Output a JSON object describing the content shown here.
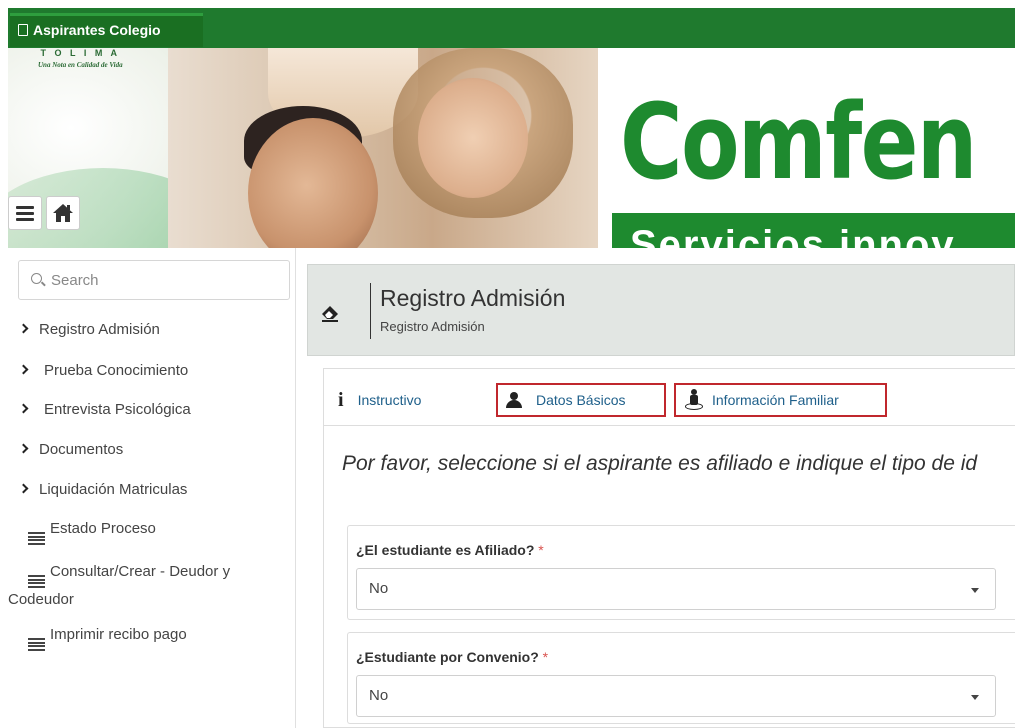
{
  "app": {
    "tab_title": "Aspirantes Colegio"
  },
  "banner": {
    "logo_region": "T O L I M A",
    "logo_tagline": "Una Nota en Calidad de Vida",
    "brand": "Comfen",
    "slogan": "Servicios innov"
  },
  "search": {
    "placeholder": "Search"
  },
  "sidebar": {
    "items": [
      {
        "label": "Registro Admisión",
        "icon": "chevron-right-icon"
      },
      {
        "label": "Prueba Conocimiento",
        "icon": "chevron-right-icon"
      },
      {
        "label": "Entrevista Psicológica",
        "icon": "chevron-right-icon"
      },
      {
        "label": "Documentos",
        "icon": "chevron-right-icon"
      },
      {
        "label": "Liquidación Matriculas",
        "icon": "chevron-right-icon"
      },
      {
        "label": "Estado Proceso",
        "icon": "list-icon"
      },
      {
        "label_line1": "Consultar/Crear - Deudor y",
        "label_line2": "Codeudor",
        "icon": "list-icon"
      },
      {
        "label": "Imprimir recibo pago",
        "icon": "list-icon"
      }
    ]
  },
  "page": {
    "title": "Registro Admisión",
    "subtitle": "Registro Admisión"
  },
  "tabs": {
    "instructivo": "Instructivo",
    "datos_basicos": "Datos Básicos",
    "informacion_familiar": "Información Familiar"
  },
  "instruction": "Por favor, seleccione si el aspirante es afiliado e indique el tipo de id",
  "form": {
    "afiliado": {
      "label": "¿El estudiante es Afiliado?",
      "required_mark": "*",
      "value": "No"
    },
    "convenio": {
      "label": "¿Estudiante por Convenio?",
      "required_mark": "*",
      "value": "No"
    }
  },
  "colors": {
    "brand_green": "#1e8a2f",
    "highlight_red": "#c0272d",
    "tab_link": "#1e5f8a"
  }
}
